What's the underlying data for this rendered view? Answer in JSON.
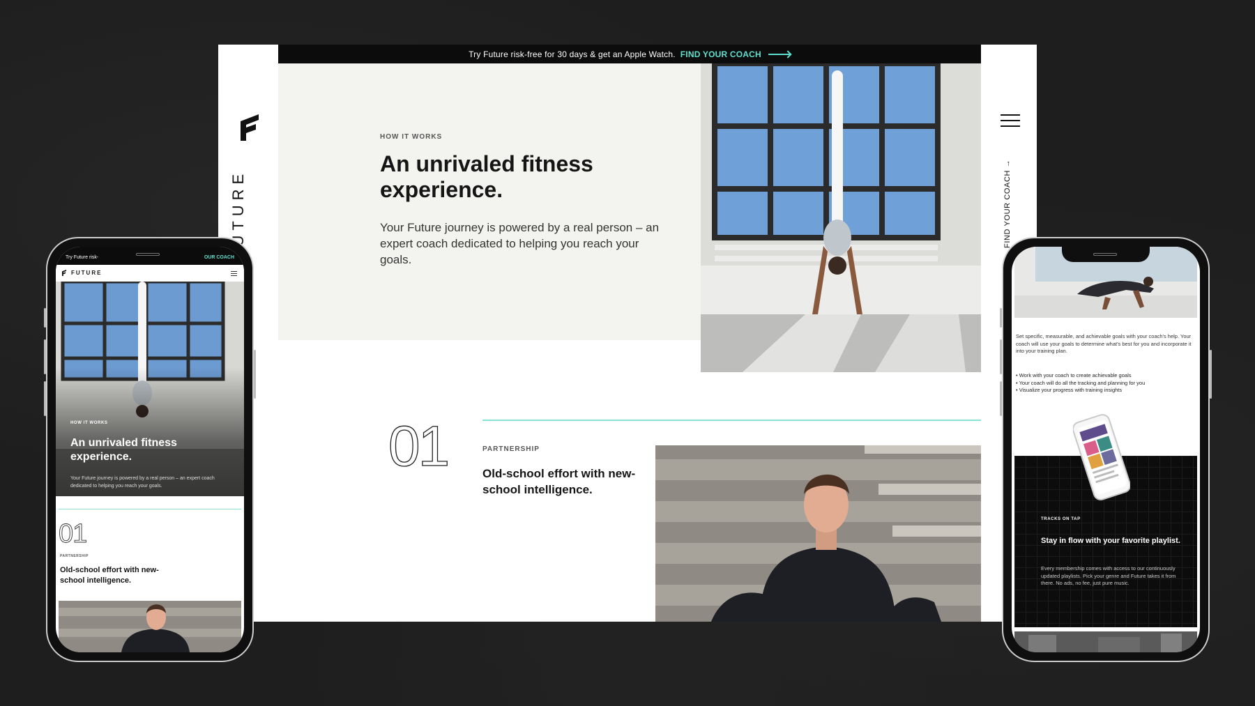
{
  "promo": {
    "text": "Try Future risk-free for 30 days & get an Apple Watch.",
    "cta": "FIND YOUR COACH"
  },
  "brand": {
    "wordmark": "FUTURE",
    "accent_color": "#5fe0cf"
  },
  "nav": {
    "side_cta": "FIND YOUR COACH →",
    "menu_icon": "hamburger-icon"
  },
  "hero": {
    "eyebrow": "HOW IT WORKS",
    "title": "An unrivaled fitness experience.",
    "body": "Your Future journey is powered by a real person – an expert coach dedicated to helping you reach your goals."
  },
  "section1": {
    "number": "01",
    "eyebrow": "PARTNERSHIP",
    "title": "Old-school effort with new-school intelligence."
  },
  "mobile_left": {
    "promo_start": "Try Future risk-",
    "promo_cta": "OUR COACH",
    "brand": "FUTURE",
    "hero_eyebrow": "HOW IT WORKS",
    "hero_title": "An unrivaled fitness experience.",
    "hero_body": "Your Future journey is powered by a real person – an expert coach dedicated to helping you reach your goals.",
    "number": "01",
    "eyebrow": "PARTNERSHIP",
    "title": "Old-school effort with new-school intelligence."
  },
  "mobile_right": {
    "goals_body": "Set specific, measurable, and achievable goals with your coach's help. Your coach will use your goals to determine what's best for you and incorporate it into your training plan.",
    "bullets": [
      "• Work with your coach to create achievable goals",
      "• Your coach will do all the tracking and planning for you",
      "• Visualize your progress with training insights"
    ],
    "music_eyebrow": "TRACKS ON TAP",
    "music_title": "Stay in flow with your favorite playlist.",
    "music_body": "Every membership comes with access to our continuously updated playlists. Pick your genre and Future takes it from there. No ads, no fee, just pure music."
  }
}
